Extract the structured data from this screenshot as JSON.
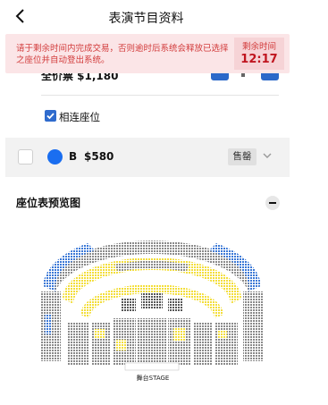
{
  "header": {
    "title": "表演节目资料",
    "back_icon": "chevron-left-icon"
  },
  "alert": {
    "message": "请于剩余时间内完成交易，否则逾时后系统会释放已选择之座位并自动登出系统。",
    "timer_label": "剩余时间",
    "timer_value": "12:17"
  },
  "previous_row": {
    "partial_text": "全价票 $1,180"
  },
  "adjacent": {
    "label": "相连座位",
    "checked": true
  },
  "price_option": {
    "code": "B",
    "price": "$580",
    "status": "售罄",
    "dot_color": "#1a6ef0"
  },
  "seat_plan": {
    "title": "座位表预览图",
    "stage_label": "舞台STAGE"
  },
  "colors": {
    "accent": "#2f6bcd",
    "alert_text": "#d23b3b",
    "yellow_zone": "#f3de3a",
    "blue_zone": "#3b78d6",
    "grey_zone": "#888888"
  }
}
